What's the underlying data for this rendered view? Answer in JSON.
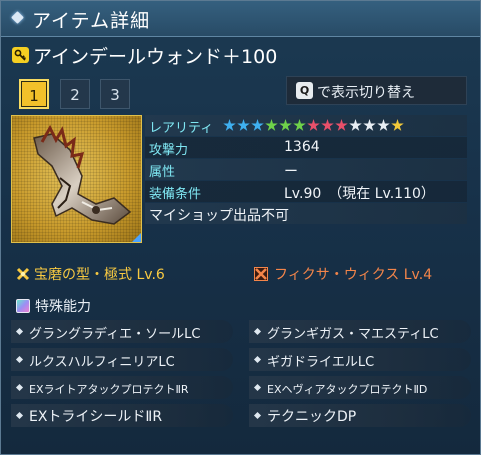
{
  "window": {
    "title": "アイテム詳細"
  },
  "item": {
    "name": "アインデールウォンド＋100"
  },
  "page_tabs": [
    {
      "label": "1",
      "active": true
    },
    {
      "label": "2",
      "active": false
    },
    {
      "label": "3",
      "active": false
    }
  ],
  "toggle": {
    "key": "Q",
    "label": "で表示切り替え"
  },
  "stats": {
    "rarity_label": "レアリティ",
    "rarity_stars": 13,
    "star_colors": [
      "#3fb0f0",
      "#3fb0f0",
      "#3fb0f0",
      "#6fd24a",
      "#6fd24a",
      "#6fd24a",
      "#e8506a",
      "#e8506a",
      "#e8506a",
      "#e8eef4",
      "#e8eef4",
      "#e8eef4",
      "#f2c93a"
    ],
    "attack_label": "攻撃力",
    "attack_value": "1364",
    "attribute_label": "属性",
    "attribute_value": "ー",
    "requirement_label": "装備条件",
    "requirement_value": "Lv.90　（現在 Lv.110）",
    "shop_note": "マイショップ出品不可"
  },
  "grind": {
    "label": "宝磨の型・極式 Lv.6"
  },
  "fixa": {
    "label": "フィクサ・ウィクス Lv.4"
  },
  "special": {
    "title": "特殊能力",
    "abilities": [
      "グラングラディエ・ソールLC",
      "グランギガス・マエスティLC",
      "ルクスハルフィニリアLC",
      "ギガドライエルLC",
      "EXライトアタックプロテクトⅡR",
      "EXヘヴィアタックプロテクトⅡD",
      "EXトライシールドⅡR",
      "テクニックDP"
    ]
  },
  "colors": {
    "accent_gold": "#f2c12a",
    "label_cyan": "#7fe6f2",
    "fixa_orange": "#f3854a"
  }
}
